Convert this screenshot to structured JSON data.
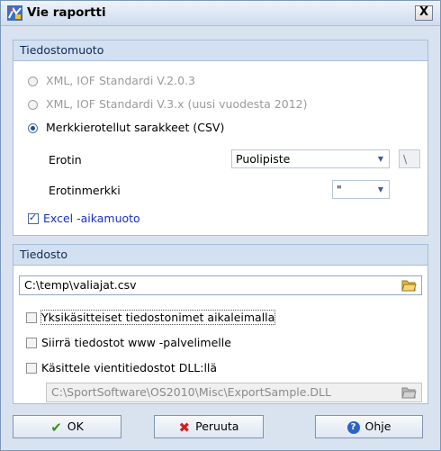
{
  "window": {
    "title": "Vie raportti",
    "close_label": "X"
  },
  "format_group": {
    "header": "Tiedostomuoto",
    "options": [
      {
        "label": "XML, IOF Standardi V.2.0.3",
        "checked": false,
        "enabled": false
      },
      {
        "label": "XML, IOF Standardi V.3.x (uusi vuodesta 2012)",
        "checked": false,
        "enabled": false
      },
      {
        "label": "Merkkierotellut sarakkeet (CSV)",
        "checked": true,
        "enabled": true
      }
    ],
    "separator": {
      "label": "Erotin",
      "value": "Puolipiste",
      "custom_value": "\\"
    },
    "quote": {
      "label": "Erotinmerkki",
      "value": "\""
    },
    "excel_time": {
      "label": "Excel -aikamuoto",
      "checked": true
    }
  },
  "file_group": {
    "header": "Tiedosto",
    "path": "C:\\temp\\valiajat.csv",
    "unique_names": {
      "label": "Yksikäsitteiset tiedostonimet aikaleimalla",
      "checked": false
    },
    "move_to_www": {
      "label": "Siirrä tiedostot www -palvelimelle",
      "checked": false
    },
    "dll_process": {
      "label": "Käsittele vientitiedostot DLL:llä",
      "checked": false
    },
    "dll_path": "C:\\SportSoftware\\OS2010\\Misc\\ExportSample.DLL"
  },
  "buttons": {
    "ok": "OK",
    "cancel": "Peruuta",
    "help": "Ohje"
  },
  "colors": {
    "ok_check": "#3f8f1f",
    "cancel_x": "#d21f1f",
    "help_blue": "#2a63c8",
    "folder": "#e7b93c"
  }
}
